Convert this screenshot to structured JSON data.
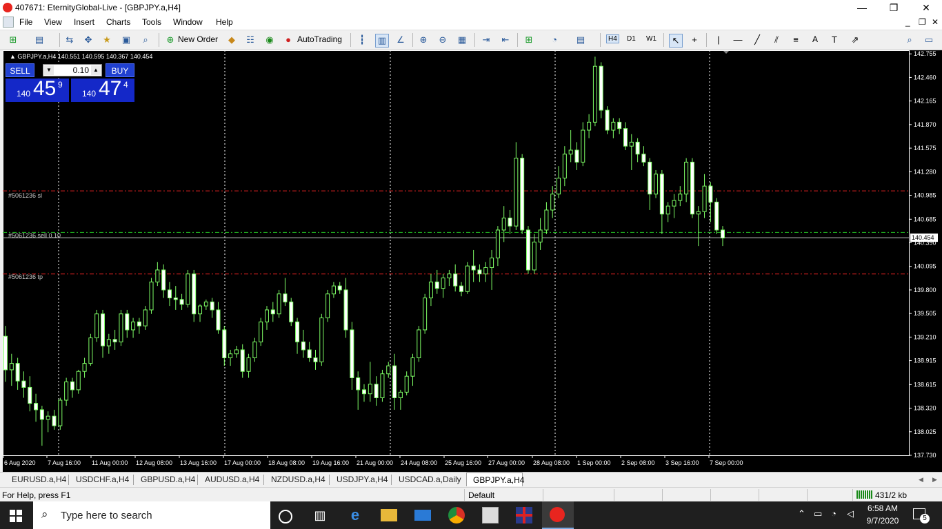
{
  "window": {
    "title": "407671: EternityGlobal-Live - [GBPJPY.a,H4]",
    "minimize": "—",
    "maximize": "❐",
    "close": "✕",
    "inner_minimize": "_",
    "inner_restore": "❐",
    "inner_close": "✕"
  },
  "menu": [
    "File",
    "View",
    "Insert",
    "Charts",
    "Tools",
    "Window",
    "Help"
  ],
  "toolbar": {
    "new_order": "New Order",
    "auto_trading": "AutoTrading",
    "periods": [
      "H4",
      "D1",
      "W1"
    ],
    "text_tool": "A"
  },
  "chart": {
    "header": "▲ GBPJPY.a,H4  140.551 140.595 140.367 140.454",
    "one_click": {
      "sell_label": "SELL",
      "buy_label": "BUY",
      "lot": "0.10",
      "sell_price_small": "140",
      "sell_price_big": "45",
      "sell_price_sup": "9",
      "buy_price_small": "140",
      "buy_price_big": "47",
      "buy_price_sup": "4"
    },
    "order_labels": {
      "sl": "#5061236 sl",
      "sell": "#5061236 sell 0.10",
      "tp": "#5061236 tp"
    },
    "current_price": "140.454"
  },
  "chart_data": {
    "type": "candlestick",
    "symbol": "GBPJPY.a",
    "timeframe": "H4",
    "y_ticks": [
      "142.755",
      "142.460",
      "142.165",
      "141.870",
      "141.575",
      "141.280",
      "140.985",
      "140.685",
      "140.390",
      "140.095",
      "139.800",
      "139.505",
      "139.210",
      "138.915",
      "138.615",
      "138.320",
      "138.025",
      "137.730"
    ],
    "x_ticks": [
      "6 Aug 2020",
      "7 Aug 16:00",
      "11 Aug 00:00",
      "12 Aug 08:00",
      "13 Aug 16:00",
      "17 Aug 00:00",
      "18 Aug 08:00",
      "19 Aug 16:00",
      "21 Aug 00:00",
      "24 Aug 08:00",
      "25 Aug 16:00",
      "27 Aug 00:00",
      "28 Aug 08:00",
      "1 Sep 00:00",
      "2 Sep 08:00",
      "3 Sep 16:00",
      "7 Sep 00:00"
    ],
    "ylim": [
      137.73,
      142.8
    ],
    "levels": {
      "sl": 141.04,
      "sell": 140.52,
      "tp": 140.0,
      "bid": 140.454
    },
    "grid": true,
    "candles": [
      [
        139.22,
        139.35,
        138.65,
        138.8
      ],
      [
        138.8,
        139.0,
        138.6,
        138.88
      ],
      [
        138.88,
        138.95,
        138.55,
        138.66
      ],
      [
        138.66,
        138.78,
        138.45,
        138.58
      ],
      [
        138.58,
        138.72,
        138.28,
        138.38
      ],
      [
        138.38,
        138.5,
        138.15,
        138.3
      ],
      [
        138.3,
        138.35,
        137.85,
        138.18
      ],
      [
        138.18,
        138.28,
        138.02,
        138.22
      ],
      [
        138.22,
        138.3,
        138.05,
        138.1
      ],
      [
        138.1,
        138.45,
        138.05,
        138.42
      ],
      [
        138.42,
        138.7,
        138.35,
        138.65
      ],
      [
        138.65,
        138.7,
        138.45,
        138.55
      ],
      [
        138.55,
        138.8,
        138.5,
        138.78
      ],
      [
        138.78,
        138.95,
        138.7,
        138.88
      ],
      [
        138.88,
        139.25,
        138.85,
        139.2
      ],
      [
        139.2,
        139.55,
        139.15,
        139.5
      ],
      [
        139.5,
        139.55,
        138.95,
        139.1
      ],
      [
        139.1,
        139.25,
        139.0,
        139.18
      ],
      [
        139.18,
        139.3,
        139.05,
        139.15
      ],
      [
        139.15,
        139.55,
        139.1,
        139.5
      ],
      [
        139.5,
        139.55,
        139.2,
        139.3
      ],
      [
        139.3,
        139.45,
        139.2,
        139.4
      ],
      [
        139.4,
        139.45,
        139.25,
        139.35
      ],
      [
        139.35,
        139.6,
        139.3,
        139.55
      ],
      [
        139.55,
        139.95,
        139.5,
        139.9
      ],
      [
        139.9,
        140.15,
        139.85,
        140.05
      ],
      [
        140.05,
        140.12,
        139.7,
        139.8
      ],
      [
        139.8,
        139.9,
        139.6,
        139.7
      ],
      [
        139.7,
        139.85,
        139.55,
        139.68
      ],
      [
        139.68,
        139.75,
        139.55,
        139.62
      ],
      [
        139.62,
        140.05,
        139.58,
        140.0
      ],
      [
        140.0,
        140.05,
        139.4,
        139.5
      ],
      [
        139.5,
        139.62,
        139.4,
        139.6
      ],
      [
        139.6,
        139.68,
        139.55,
        139.65
      ],
      [
        139.65,
        139.7,
        139.45,
        139.55
      ],
      [
        139.55,
        139.65,
        139.25,
        139.3
      ],
      [
        139.3,
        139.35,
        138.85,
        138.95
      ],
      [
        138.95,
        139.05,
        138.85,
        139.0
      ],
      [
        139.0,
        139.1,
        138.95,
        139.05
      ],
      [
        139.05,
        139.12,
        138.7,
        138.78
      ],
      [
        138.78,
        139.0,
        138.7,
        138.95
      ],
      [
        138.95,
        139.2,
        138.9,
        139.15
      ],
      [
        139.15,
        139.45,
        139.1,
        139.4
      ],
      [
        139.4,
        139.6,
        139.3,
        139.55
      ],
      [
        139.55,
        139.65,
        139.4,
        139.5
      ],
      [
        139.5,
        139.8,
        139.45,
        139.75
      ],
      [
        139.75,
        139.95,
        139.6,
        139.65
      ],
      [
        139.65,
        139.7,
        139.35,
        139.4
      ],
      [
        139.4,
        139.45,
        139.0,
        139.15
      ],
      [
        139.15,
        139.3,
        138.95,
        139.05
      ],
      [
        139.05,
        139.15,
        138.9,
        138.95
      ],
      [
        138.95,
        139.05,
        138.8,
        138.9
      ],
      [
        138.9,
        139.5,
        138.85,
        139.45
      ],
      [
        139.45,
        139.8,
        139.4,
        139.75
      ],
      [
        139.75,
        139.9,
        139.7,
        139.85
      ],
      [
        139.85,
        139.9,
        139.75,
        139.8
      ],
      [
        139.8,
        139.95,
        139.2,
        139.3
      ],
      [
        139.3,
        139.4,
        138.55,
        138.7
      ],
      [
        138.7,
        138.78,
        138.3,
        138.55
      ],
      [
        138.55,
        138.62,
        138.4,
        138.5
      ],
      [
        138.5,
        138.9,
        138.4,
        138.62
      ],
      [
        138.62,
        138.72,
        138.35,
        138.45
      ],
      [
        138.45,
        138.8,
        138.4,
        138.75
      ],
      [
        138.75,
        138.9,
        138.7,
        138.85
      ],
      [
        138.85,
        139.0,
        138.3,
        138.45
      ],
      [
        138.45,
        138.55,
        138.3,
        138.52
      ],
      [
        138.52,
        138.78,
        138.48,
        138.72
      ],
      [
        138.72,
        139.0,
        138.6,
        138.95
      ],
      [
        138.95,
        139.35,
        138.9,
        139.3
      ],
      [
        139.3,
        139.75,
        139.25,
        139.7
      ],
      [
        139.7,
        140.0,
        139.6,
        139.9
      ],
      [
        139.9,
        140.05,
        139.75,
        139.82
      ],
      [
        139.82,
        140.0,
        139.7,
        139.95
      ],
      [
        139.95,
        140.05,
        139.85,
        140.0
      ],
      [
        140.0,
        140.12,
        139.78,
        139.85
      ],
      [
        139.85,
        139.9,
        139.72,
        139.78
      ],
      [
        139.78,
        140.15,
        139.75,
        140.1
      ],
      [
        140.1,
        140.3,
        139.9,
        140.05
      ],
      [
        140.05,
        140.12,
        139.9,
        140.0
      ],
      [
        140.0,
        140.15,
        139.9,
        140.08
      ],
      [
        140.08,
        140.3,
        139.8,
        140.2
      ],
      [
        140.2,
        140.6,
        140.1,
        140.55
      ],
      [
        140.55,
        140.85,
        140.4,
        140.7
      ],
      [
        140.7,
        140.8,
        140.5,
        140.6
      ],
      [
        140.6,
        141.65,
        140.55,
        141.45
      ],
      [
        141.45,
        141.5,
        140.5,
        140.55
      ],
      [
        140.55,
        140.6,
        140.0,
        140.05
      ],
      [
        140.05,
        140.5,
        140.0,
        140.4
      ],
      [
        140.4,
        140.7,
        140.3,
        140.55
      ],
      [
        140.55,
        140.9,
        140.5,
        140.8
      ],
      [
        140.8,
        141.1,
        140.7,
        141.0
      ],
      [
        141.0,
        141.35,
        140.95,
        141.2
      ],
      [
        141.2,
        141.6,
        141.1,
        141.5
      ],
      [
        141.5,
        141.8,
        141.4,
        141.55
      ],
      [
        141.55,
        141.65,
        141.3,
        141.4
      ],
      [
        141.4,
        141.9,
        141.35,
        141.8
      ],
      [
        141.8,
        142.0,
        141.7,
        141.9
      ],
      [
        141.9,
        142.72,
        141.85,
        142.6
      ],
      [
        142.6,
        142.65,
        141.95,
        142.05
      ],
      [
        142.05,
        142.1,
        141.75,
        141.8
      ],
      [
        141.8,
        141.95,
        141.7,
        141.9
      ],
      [
        141.9,
        141.95,
        141.75,
        141.82
      ],
      [
        141.82,
        141.9,
        141.55,
        141.6
      ],
      [
        141.6,
        141.75,
        141.3,
        141.65
      ],
      [
        141.65,
        141.7,
        141.4,
        141.5
      ],
      [
        141.5,
        141.6,
        141.35,
        141.4
      ],
      [
        141.4,
        141.45,
        140.8,
        141.0
      ],
      [
        141.0,
        141.3,
        140.95,
        141.25
      ],
      [
        141.25,
        141.3,
        140.5,
        140.75
      ],
      [
        140.75,
        140.9,
        140.65,
        140.85
      ],
      [
        140.85,
        141.0,
        140.7,
        140.92
      ],
      [
        140.92,
        141.1,
        140.85,
        141.0
      ],
      [
        141.0,
        141.45,
        140.9,
        141.4
      ],
      [
        141.4,
        141.45,
        140.7,
        140.75
      ],
      [
        140.75,
        140.85,
        140.35,
        140.78
      ],
      [
        140.78,
        141.25,
        140.7,
        141.1
      ],
      [
        141.1,
        141.15,
        140.65,
        140.9
      ],
      [
        140.9,
        140.95,
        140.5,
        140.55
      ],
      [
        140.55,
        140.6,
        140.35,
        140.45
      ]
    ]
  },
  "tabs": [
    "EURUSD.a,H4",
    "USDCHF.a,H4",
    "GBPUSD.a,H4",
    "AUDUSD.a,H4",
    "NZDUSD.a,H4",
    "USDJPY.a,H4",
    "USDCAD.a,Daily",
    "GBPJPY.a,H4"
  ],
  "status": {
    "help": "For Help, press F1",
    "profile": "Default",
    "traffic": "431/2 kb"
  },
  "taskbar": {
    "search_placeholder": "Type here to search",
    "time": "6:58 AM",
    "date": "9/7/2020",
    "notification_count": "5"
  }
}
